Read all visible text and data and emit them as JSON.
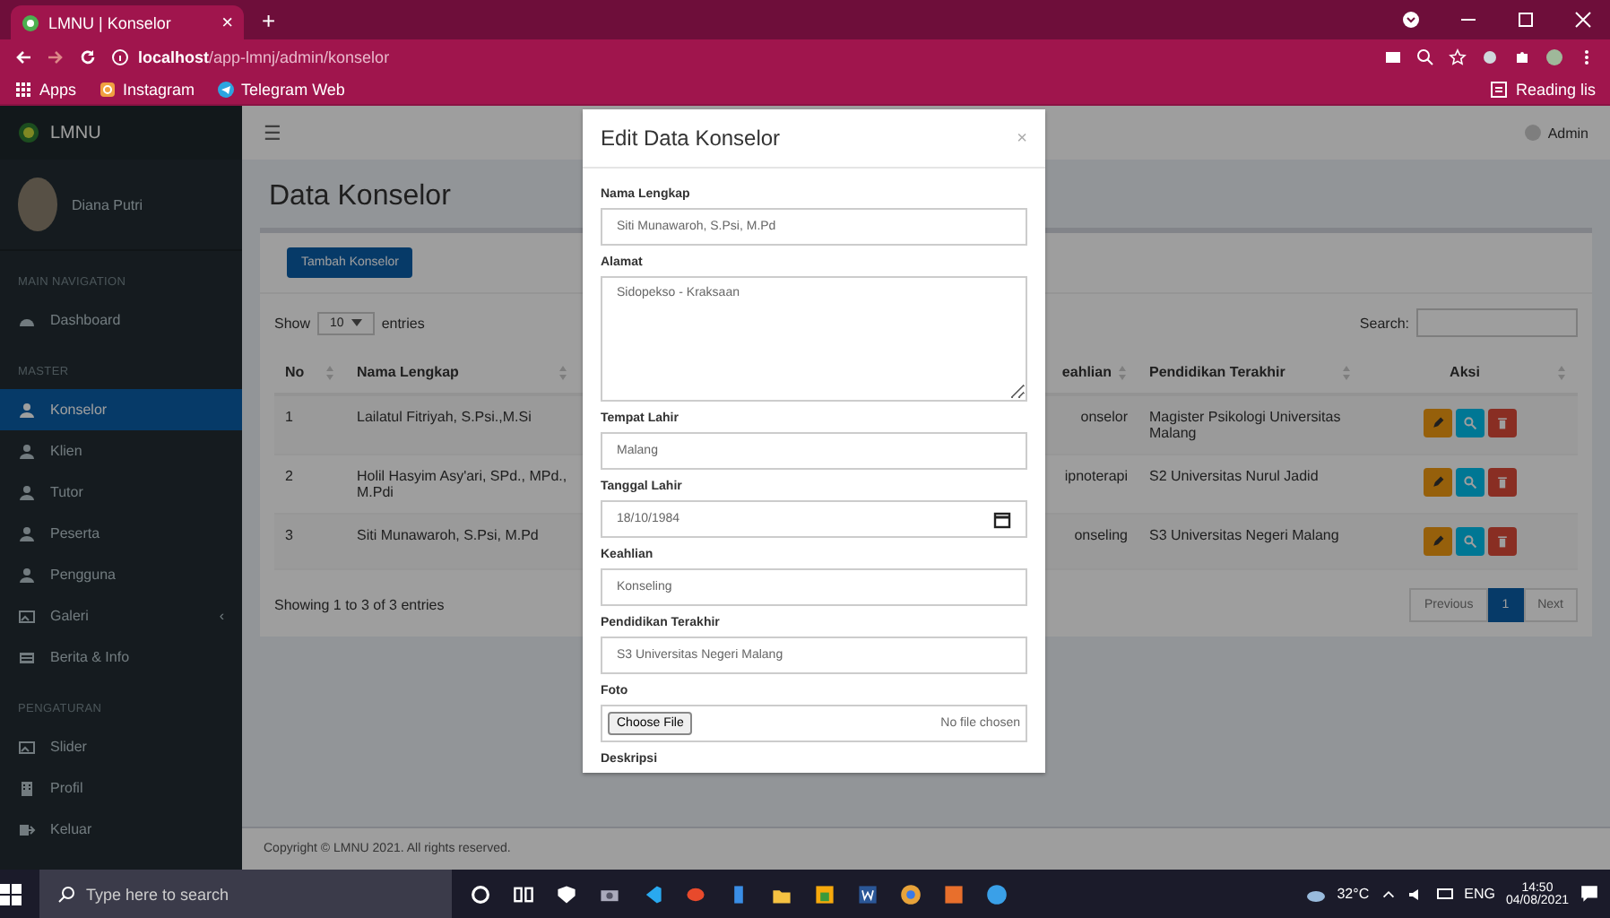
{
  "browser": {
    "tab_title": "LMNU | Konselor",
    "tab_close": "×",
    "new_tab": "+",
    "url_host": "localhost",
    "url_path": "/app-lmnj/admin/konselor",
    "bookmarks": [
      {
        "label": "Apps",
        "kind": "grid"
      },
      {
        "label": "Instagram",
        "kind": "insta"
      },
      {
        "label": "Telegram Web",
        "kind": "telegram"
      }
    ],
    "reading_list": "Reading lis"
  },
  "sidebar": {
    "brand": "LMNU",
    "user": "Diana Putri",
    "groups": [
      {
        "title": "MAIN NAVIGATION",
        "items": [
          {
            "label": "Dashboard",
            "kind": "dashboard",
            "selected": false
          }
        ]
      },
      {
        "title": "MASTER",
        "items": [
          {
            "label": "Konselor",
            "kind": "user",
            "selected": true
          },
          {
            "label": "Klien",
            "kind": "user",
            "selected": false
          },
          {
            "label": "Tutor",
            "kind": "user",
            "selected": false
          },
          {
            "label": "Peserta",
            "kind": "user",
            "selected": false
          },
          {
            "label": "Pengguna",
            "kind": "user",
            "selected": false
          },
          {
            "label": "Galeri",
            "kind": "image",
            "selected": false,
            "chevron": "‹"
          },
          {
            "label": "Berita & Info",
            "kind": "news",
            "selected": false
          }
        ]
      },
      {
        "title": "PENGATURAN",
        "items": [
          {
            "label": "Slider",
            "kind": "image",
            "selected": false
          },
          {
            "label": "Profil",
            "kind": "building",
            "selected": false
          },
          {
            "label": "Keluar",
            "kind": "exit",
            "selected": false
          }
        ]
      }
    ]
  },
  "navbar": {
    "menu": "☰",
    "user": "Admin"
  },
  "page": {
    "title": "Data Konselor",
    "add_button": "Tambah Konselor",
    "show": "Show",
    "length": "10",
    "entries": "entries",
    "search_label": "Search:",
    "columns": [
      {
        "label": "No"
      },
      {
        "label": "Nama Lengkap"
      },
      {
        "label": "eahlian"
      },
      {
        "label": "Pendidikan Terakhir"
      },
      {
        "label": "Aksi"
      }
    ],
    "rows": [
      {
        "no": "1",
        "name": "Lailatul Fitriyah, S.Psi.,M.Si",
        "keahlian": "onselor",
        "pendidikan": "Magister Psikologi Universitas Malang",
        "actions": [
          {
            "kind": "edit"
          },
          {
            "kind": "view"
          },
          {
            "kind": "delete"
          }
        ]
      },
      {
        "no": "2",
        "name": "Holil Hasyim Asy'ari, SPd., MPd., M.Pdi",
        "keahlian": "ipnoterapi",
        "pendidikan": "S2 Universitas Nurul Jadid",
        "actions": [
          {
            "kind": "edit"
          },
          {
            "kind": "view"
          },
          {
            "kind": "delete"
          }
        ]
      },
      {
        "no": "3",
        "name": "Siti Munawaroh, S.Psi, M.Pd",
        "keahlian": "onseling",
        "pendidikan": "S3 Universitas Negeri Malang",
        "actions": [
          {
            "kind": "edit"
          },
          {
            "kind": "view"
          },
          {
            "kind": "delete"
          }
        ]
      }
    ],
    "info": "Showing 1 to 3 of 3 entries",
    "pages": [
      {
        "label": "Previous",
        "selected": false
      },
      {
        "label": "1",
        "selected": true
      },
      {
        "label": "Next",
        "selected": false
      }
    ],
    "footer": "Copyright © LMNU 2021. All rights reserved."
  },
  "modal": {
    "title": "Edit Data Konselor",
    "close": "×",
    "fields": [
      {
        "label": "Nama Lengkap",
        "kind": "text",
        "value": "Siti Munawaroh, S.Psi, M.Pd"
      },
      {
        "label": "Alamat",
        "kind": "textarea",
        "value": "Sidopekso - Kraksaan"
      },
      {
        "label": "Tempat Lahir",
        "kind": "text",
        "value": "Malang"
      },
      {
        "label": "Tanggal Lahir",
        "kind": "date",
        "value": "18/10/1984"
      },
      {
        "label": "Keahlian",
        "kind": "text",
        "value": "Konseling"
      },
      {
        "label": "Pendidikan Terakhir",
        "kind": "text",
        "value": "S3 Universitas Negeri Malang"
      },
      {
        "label": "Foto",
        "kind": "file",
        "button": "Choose File",
        "value": "No file chosen"
      },
      {
        "label": "Deskripsi",
        "kind": "label"
      }
    ]
  },
  "taskbar": {
    "search_placeholder": "Type here to search",
    "weather": "32°C",
    "language": "ENG",
    "time": "14:50",
    "date": "04/08/2021"
  }
}
